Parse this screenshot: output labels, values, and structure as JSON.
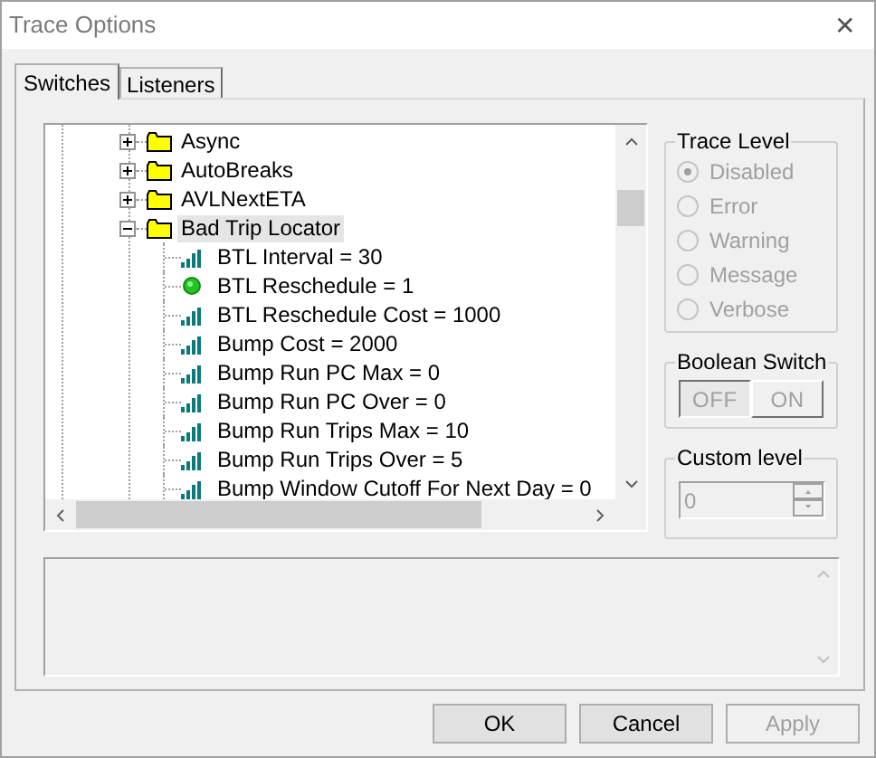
{
  "window": {
    "title": "Trace Options",
    "close": "✕"
  },
  "tabs": [
    {
      "label": "Switches",
      "selected": true
    },
    {
      "label": "Listeners",
      "selected": false
    }
  ],
  "tree": [
    {
      "label": "Async",
      "kind": "folder",
      "expanded": false,
      "selected": false
    },
    {
      "label": "AutoBreaks",
      "kind": "folder",
      "expanded": false,
      "selected": false
    },
    {
      "label": "AVLNextETA",
      "kind": "folder",
      "expanded": false,
      "selected": false
    },
    {
      "label": "Bad Trip Locator",
      "kind": "folder",
      "expanded": true,
      "selected": true,
      "children": [
        {
          "label": "BTL Interval = 30",
          "kind": "numeric",
          "selected": false
        },
        {
          "label": "BTL Reschedule = 1",
          "kind": "boolean",
          "selected": false
        },
        {
          "label": "BTL Reschedule Cost = 1000",
          "kind": "numeric",
          "selected": false
        },
        {
          "label": "Bump Cost = 2000",
          "kind": "numeric",
          "selected": false
        },
        {
          "label": "Bump Run PC Max = 0",
          "kind": "numeric",
          "selected": false
        },
        {
          "label": "Bump Run PC Over = 0",
          "kind": "numeric",
          "selected": false
        },
        {
          "label": "Bump Run Trips Max = 10",
          "kind": "numeric",
          "selected": false
        },
        {
          "label": "Bump Run Trips Over = 5",
          "kind": "numeric",
          "selected": false
        },
        {
          "label": "Bump Window Cutoff For Next Day = 0",
          "kind": "numeric",
          "selected": false
        }
      ]
    }
  ],
  "trace_level": {
    "title": "Trace Level",
    "disabled": true,
    "options": [
      {
        "label": "Disabled",
        "selected": true
      },
      {
        "label": "Error",
        "selected": false
      },
      {
        "label": "Warning",
        "selected": false
      },
      {
        "label": "Message",
        "selected": false
      },
      {
        "label": "Verbose",
        "selected": false
      }
    ]
  },
  "boolean_switch": {
    "title": "Boolean Switch",
    "disabled": true,
    "options": [
      {
        "label": "OFF",
        "selected": true
      },
      {
        "label": "ON",
        "selected": false
      }
    ]
  },
  "custom_level": {
    "title": "Custom level",
    "value": "0",
    "disabled": true
  },
  "buttons": [
    {
      "label": "OK",
      "disabled": false
    },
    {
      "label": "Cancel",
      "disabled": false
    },
    {
      "label": "Apply",
      "disabled": true
    }
  ]
}
